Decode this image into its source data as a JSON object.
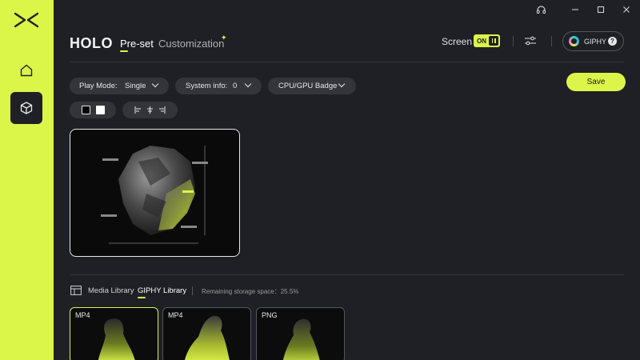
{
  "app": {
    "title": "HOLO"
  },
  "tabs": {
    "preset": "Pre-set",
    "customization": "Customization"
  },
  "header": {
    "screen_label": "Screen",
    "screen_toggle": "ON",
    "giphy_label": "GIPHY",
    "help_symbol": "?"
  },
  "controls": {
    "play_mode_label": "Play Mode:",
    "play_mode_value": "Single",
    "system_info_label": "System info:",
    "system_info_value": "0",
    "badge_label": "CPU/GPU Badge",
    "save_label": "Save",
    "swatches": [
      "#000000",
      "#ffffff"
    ]
  },
  "library": {
    "media_tab": "Media Library",
    "giphy_tab": "GIPHY Library",
    "storage_text": "Remaining storage space：25.5%",
    "items": [
      {
        "format": "MP4",
        "selected": true
      },
      {
        "format": "MP4",
        "selected": false
      },
      {
        "format": "PNG",
        "selected": false
      }
    ]
  },
  "colors": {
    "accent": "#dcf549",
    "background": "#1f2025",
    "pill": "#34353b"
  },
  "icons": [
    "app-logo-icon",
    "home-icon",
    "cube-icon",
    "headset-icon",
    "minimize-icon",
    "maximize-icon",
    "close-icon",
    "sliders-icon",
    "giphy-logo-icon",
    "help-icon",
    "chevron-down-icon",
    "align-left-icon",
    "align-center-icon",
    "align-right-icon",
    "media-library-icon"
  ]
}
